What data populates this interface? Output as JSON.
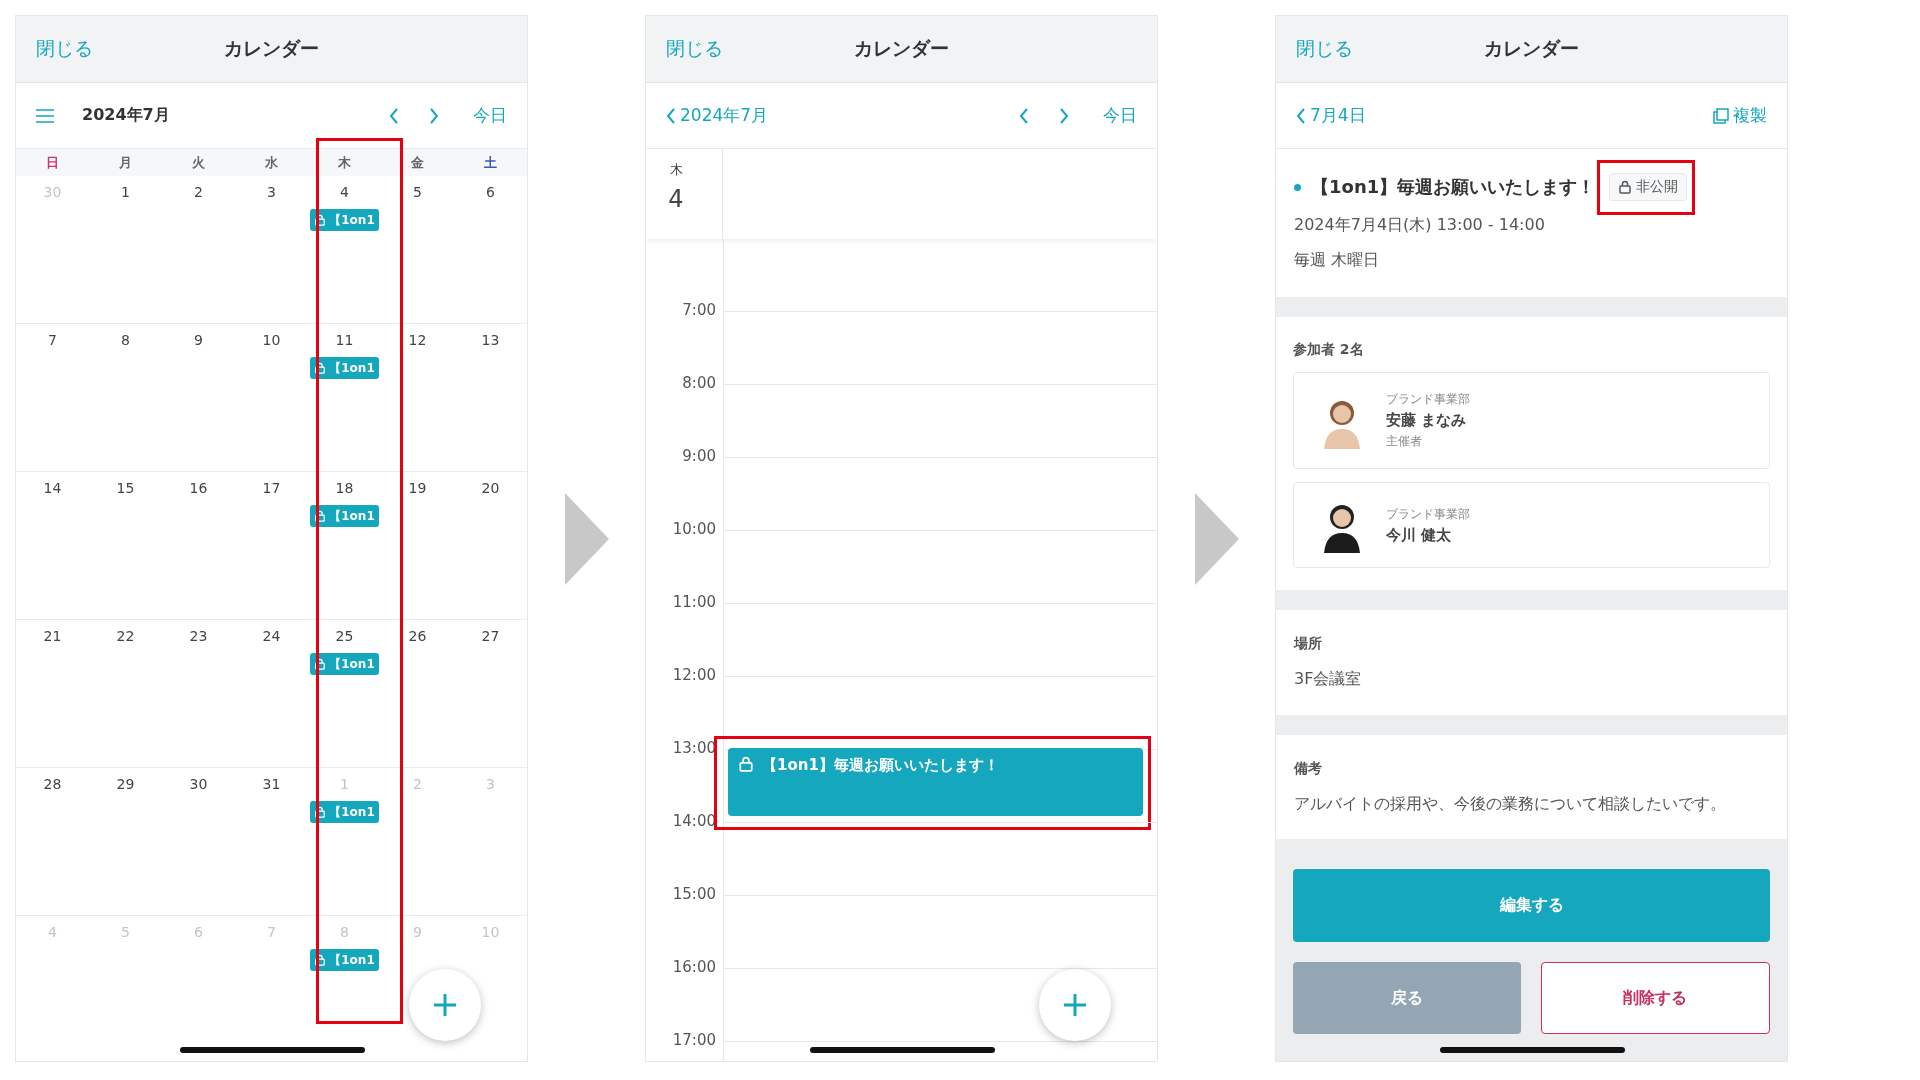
{
  "screens": [
    {
      "kind": "month",
      "header": {
        "close": "閉じる",
        "title": "カレンダー"
      },
      "toolbar": {
        "month": "2024年7月",
        "today": "今日"
      },
      "weekdays": [
        {
          "label": "日",
          "color": "#d6336c",
          "highlighted": false
        },
        {
          "label": "月",
          "color": "#666666",
          "highlighted": false
        },
        {
          "label": "火",
          "color": "#666666",
          "highlighted": false
        },
        {
          "label": "水",
          "color": "#666666",
          "highlighted": false
        },
        {
          "label": "木",
          "color": "#666666",
          "highlighted": true
        },
        {
          "label": "金",
          "color": "#666666",
          "highlighted": false
        },
        {
          "label": "土",
          "color": "#3b5bab",
          "highlighted": false
        }
      ],
      "weeks": [
        {
          "days": [
            {
              "label": "30",
              "outside_month": true
            },
            {
              "label": "1",
              "outside_month": false
            },
            {
              "label": "2",
              "outside_month": false
            },
            {
              "label": "3",
              "outside_month": false
            },
            {
              "label": "4",
              "outside_month": false,
              "events": [
                {
                  "title": "【1on1",
                  "private": true
                }
              ]
            },
            {
              "label": "5",
              "outside_month": false
            },
            {
              "label": "6",
              "outside_month": false
            }
          ]
        },
        {
          "days": [
            {
              "label": "7",
              "outside_month": false
            },
            {
              "label": "8",
              "outside_month": false
            },
            {
              "label": "9",
              "outside_month": false
            },
            {
              "label": "10",
              "outside_month": false
            },
            {
              "label": "11",
              "outside_month": false,
              "events": [
                {
                  "title": "【1on1",
                  "private": true
                }
              ]
            },
            {
              "label": "12",
              "outside_month": false
            },
            {
              "label": "13",
              "outside_month": false
            }
          ]
        },
        {
          "days": [
            {
              "label": "14",
              "outside_month": false
            },
            {
              "label": "15",
              "outside_month": false
            },
            {
              "label": "16",
              "outside_month": false
            },
            {
              "label": "17",
              "outside_month": false
            },
            {
              "label": "18",
              "outside_month": false,
              "events": [
                {
                  "title": "【1on1",
                  "private": true
                }
              ]
            },
            {
              "label": "19",
              "outside_month": false
            },
            {
              "label": "20",
              "outside_month": false
            }
          ]
        },
        {
          "days": [
            {
              "label": "21",
              "outside_month": false
            },
            {
              "label": "22",
              "outside_month": false
            },
            {
              "label": "23",
              "outside_month": false
            },
            {
              "label": "24",
              "outside_month": false
            },
            {
              "label": "25",
              "outside_month": false,
              "events": [
                {
                  "title": "【1on1",
                  "private": true
                }
              ]
            },
            {
              "label": "26",
              "outside_month": false
            },
            {
              "label": "27",
              "outside_month": false
            }
          ]
        },
        {
          "days": [
            {
              "label": "28",
              "outside_month": false
            },
            {
              "label": "29",
              "outside_month": false
            },
            {
              "label": "30",
              "outside_month": false
            },
            {
              "label": "31",
              "outside_month": false
            },
            {
              "label": "1",
              "outside_month": true,
              "events": [
                {
                  "title": "【1on1",
                  "private": true
                }
              ]
            },
            {
              "label": "2",
              "outside_month": true
            },
            {
              "label": "3",
              "outside_month": true
            }
          ]
        },
        {
          "days": [
            {
              "label": "4",
              "outside_month": true
            },
            {
              "label": "5",
              "outside_month": true
            },
            {
              "label": "6",
              "outside_month": true
            },
            {
              "label": "7",
              "outside_month": true
            },
            {
              "label": "8",
              "outside_month": true,
              "events": [
                {
                  "title": "【1on1",
                  "private": true
                }
              ]
            },
            {
              "label": "9",
              "outside_month": true
            },
            {
              "label": "10",
              "outside_month": true
            }
          ]
        }
      ]
    },
    {
      "kind": "day",
      "header": {
        "close": "閉じる",
        "title": "カレンダー"
      },
      "toolbar": {
        "back": "2024年7月",
        "today": "今日"
      },
      "day": {
        "weekday": "木",
        "date": "4"
      },
      "hours": [
        {
          "label": "7:00"
        },
        {
          "label": "8:00"
        },
        {
          "label": "9:00"
        },
        {
          "label": "10:00"
        },
        {
          "label": "11:00"
        },
        {
          "label": "12:00"
        },
        {
          "label": "13:00",
          "events": [
            {
              "title": "【1on1】毎週お願いいたします！",
              "private": true,
              "highlighted": true
            }
          ]
        },
        {
          "label": "14:00"
        },
        {
          "label": "15:00"
        },
        {
          "label": "16:00"
        },
        {
          "label": "17:00"
        }
      ]
    },
    {
      "kind": "detail",
      "header": {
        "close": "閉じる",
        "title": "カレンダー"
      },
      "toolbar": {
        "back": "7月4日",
        "duplicate": "複製"
      },
      "event": {
        "title": "【1on1】毎週お願いいたします！",
        "color": "#14a7bd",
        "visibility": {
          "label": "非公開",
          "highlighted": true
        },
        "datetime": "2024年7月4日(木) 13:00 - 14:00",
        "repeat": "毎週 木曜日"
      },
      "participants": {
        "heading": "参加者 2名",
        "people": [
          {
            "department": "ブランド事業部",
            "name": "安藤 まなみ",
            "role": "主催者"
          },
          {
            "department": "ブランド事業部",
            "name": "今川 健太"
          }
        ]
      },
      "location": {
        "heading": "場所",
        "value": "3F会議室"
      },
      "notes": {
        "heading": "備考",
        "value": "アルバイトの採用や、今後の業務について相談したいです。"
      },
      "actions": [
        {
          "label": "編集する",
          "kind": "primary"
        },
        {
          "label": "戻る",
          "kind": "secondary"
        },
        {
          "label": "削除する",
          "kind": "danger"
        }
      ]
    }
  ]
}
